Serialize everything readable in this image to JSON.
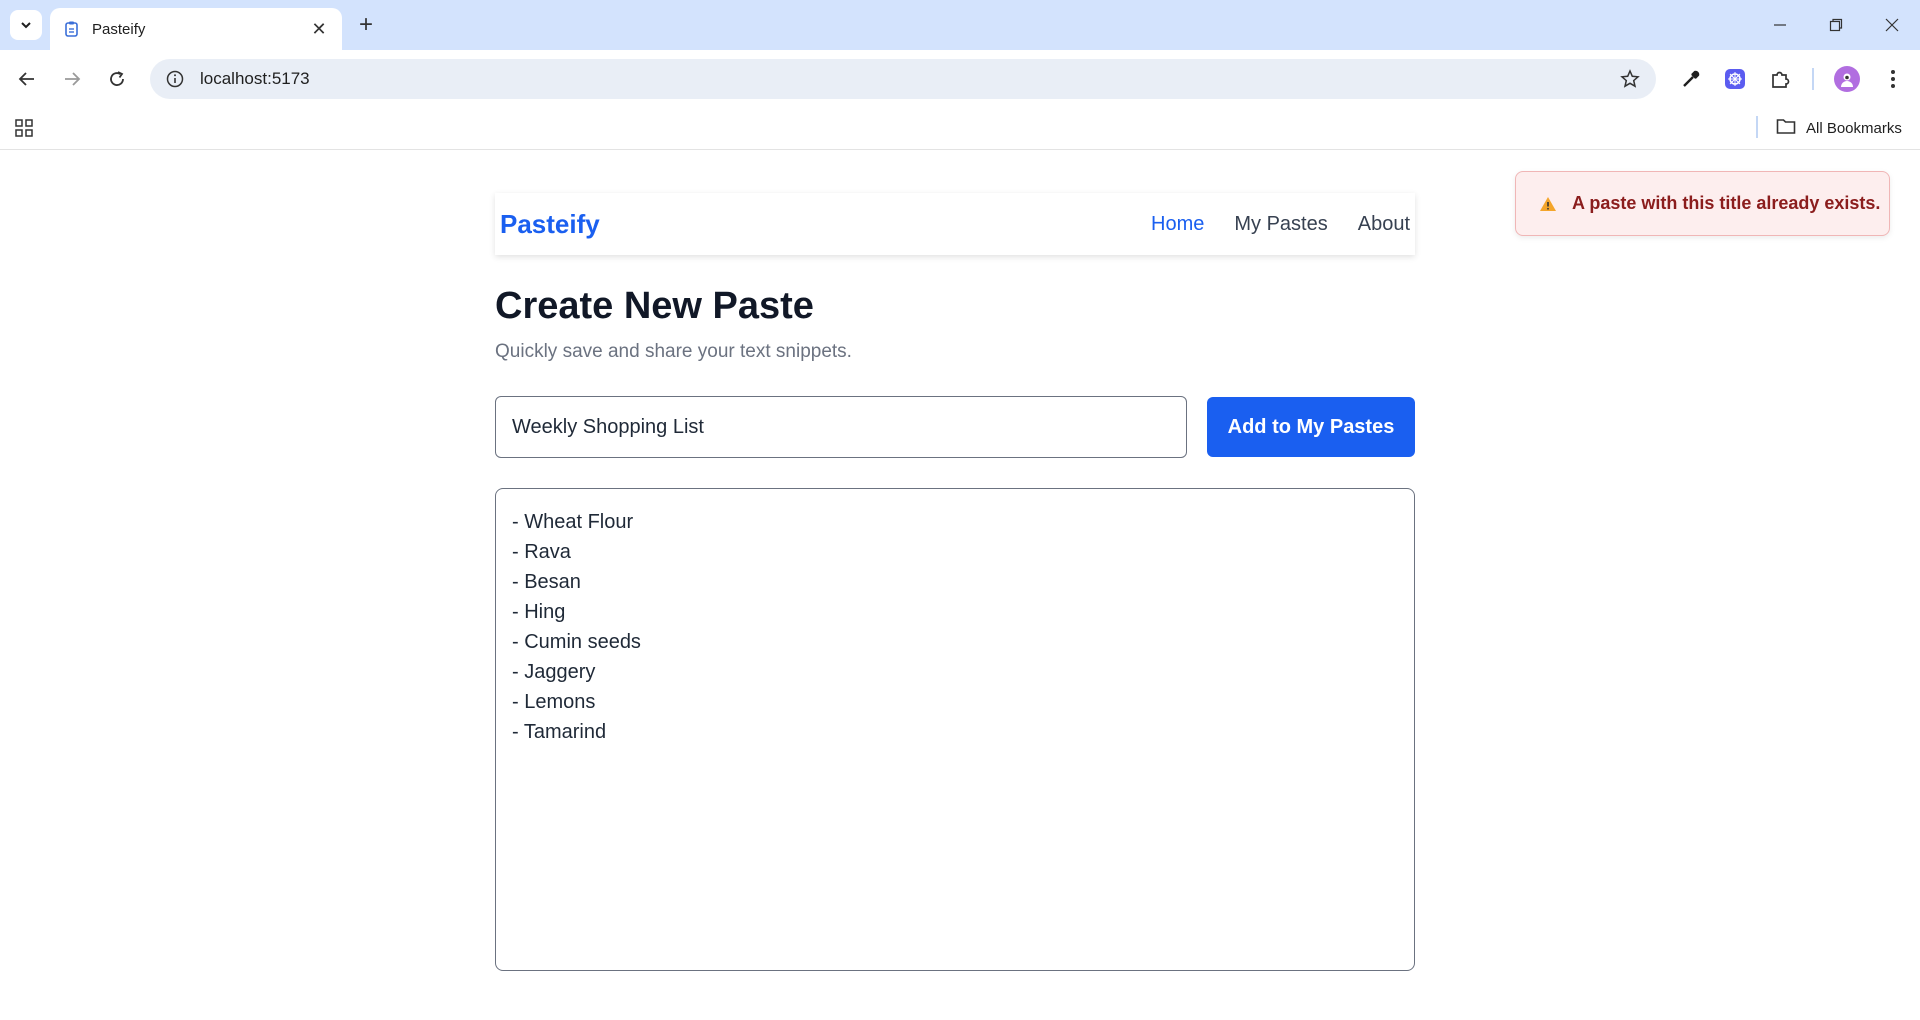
{
  "browser": {
    "tab_title": "Pasteify",
    "url": "localhost:5173",
    "bookmarks_label": "All Bookmarks",
    "icons": [
      "tab-search-icon",
      "pasteify-favicon-icon",
      "close-icon",
      "plus-icon",
      "minimize-icon",
      "restore-icon",
      "window-close-icon",
      "back-icon",
      "forward-icon",
      "reload-icon",
      "site-info-icon",
      "star-icon",
      "eyedropper-icon",
      "extension-app-icon",
      "puzzle-icon",
      "profile-avatar-icon",
      "menu-dots-icon",
      "apps-grid-icon",
      "folder-icon"
    ]
  },
  "navbar": {
    "brand": "Pasteify",
    "links": [
      {
        "label": "Home",
        "active": true
      },
      {
        "label": "My Pastes",
        "active": false
      },
      {
        "label": "About",
        "active": false
      }
    ]
  },
  "main": {
    "heading": "Create New Paste",
    "subheading": "Quickly save and share your text snippets.",
    "title_input_value": "Weekly Shopping List",
    "add_button_label": "Add to My Pastes",
    "content_lines": [
      "- Wheat Flour",
      "- Rava",
      "- Besan",
      "- Hing",
      "- Cumin seeds",
      "- Jaggery",
      "- Lemons",
      "- Tamarind"
    ]
  },
  "toast": {
    "icon": "warning-icon",
    "message": "A paste with this title already exists."
  },
  "colors": {
    "brand": "#1a5ff0",
    "toast_bg": "#fdeeee",
    "toast_text": "#8b1d1d"
  }
}
